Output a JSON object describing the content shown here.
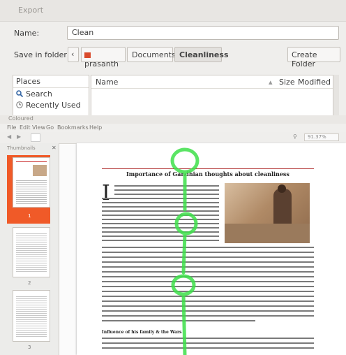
{
  "dialog": {
    "title": "Export",
    "name_label": "Name:",
    "name_value": "Clean",
    "save_in_label": "Save in folder:",
    "breadcrumb_back": "‹",
    "breadcrumbs": [
      "prasanth",
      "Documents",
      "Cleanliness"
    ],
    "create_folder_label": "Create Folder",
    "places": {
      "header": "Places",
      "items": [
        {
          "label": "Search",
          "icon": "search-icon"
        },
        {
          "label": "Recently Used",
          "icon": "clock-icon"
        }
      ]
    },
    "files": {
      "col_name": "Name",
      "col_size": "Size",
      "col_modified": "Modified"
    }
  },
  "viewer": {
    "title": "Coloured",
    "menu": [
      "File",
      "Edit",
      "View",
      "Go",
      "Bookmarks",
      "Help"
    ],
    "zoom": "91.37%",
    "sidebar_header": "Thumbnails",
    "thumb_labels": [
      "1",
      "2",
      "3"
    ],
    "article_title": "Importance of Gandhian thoughts about cleanliness",
    "dropcap": "I",
    "section_heading": "Influence of his family & the Wars",
    "accent": "#f05a28",
    "overlay_color": "#3ee04a"
  }
}
